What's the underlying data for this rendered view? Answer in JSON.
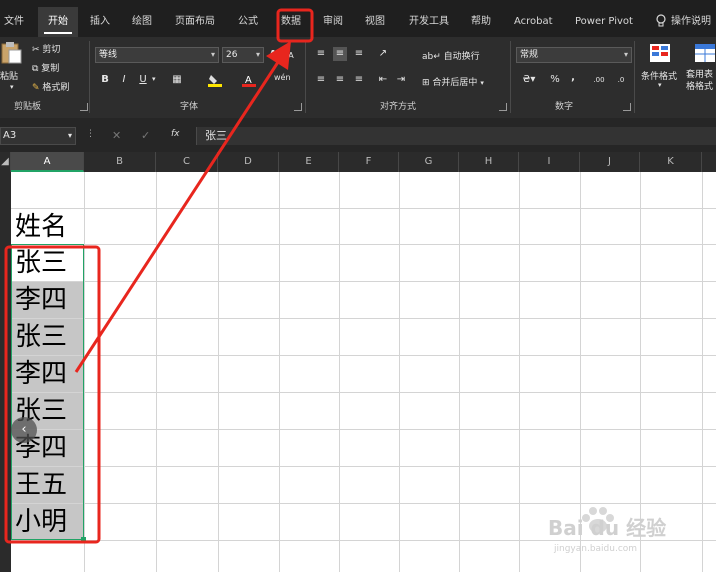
{
  "tabs": [
    {
      "label": "文件"
    },
    {
      "label": "开始"
    },
    {
      "label": "插入"
    },
    {
      "label": "绘图"
    },
    {
      "label": "页面布局"
    },
    {
      "label": "公式"
    },
    {
      "label": "数据"
    },
    {
      "label": "审阅"
    },
    {
      "label": "视图"
    },
    {
      "label": "开发工具"
    },
    {
      "label": "帮助"
    },
    {
      "label": "Acrobat"
    },
    {
      "label": "Power Pivot"
    }
  ],
  "active_tab": "开始",
  "highlighted_tab": "数据",
  "tell_me": "操作说明",
  "ribbon": {
    "clipboard": {
      "paste": "粘贴",
      "cut": "剪切",
      "copy": "复制",
      "format_painter": "格式刷",
      "group_label": "剪贴板"
    },
    "font": {
      "font_name": "等线",
      "font_size": "26",
      "bold": "B",
      "italic": "I",
      "underline": "U",
      "grow": "A",
      "shrink": "A",
      "phonetic": "wén",
      "group_label": "字体"
    },
    "alignment": {
      "wrap_text": "自动换行",
      "merge_center": "合并后居中",
      "group_label": "对齐方式"
    },
    "number": {
      "format": "常规",
      "percent": "%",
      "comma": ",",
      "group_label": "数字"
    },
    "styles": {
      "conditional_format": "条件格式",
      "table_format": "套用表格格式"
    }
  },
  "formula_bar": {
    "name_box": "A3",
    "fx": "fx",
    "content": "张三"
  },
  "columns": [
    "A",
    "B",
    "C",
    "D",
    "E",
    "F",
    "G",
    "H",
    "I",
    "J",
    "K"
  ],
  "selected_column": "A",
  "cells_col_a": [
    "姓名",
    "张三",
    "李四",
    "张三",
    "李四",
    "张三",
    "李四",
    "王五",
    "小明"
  ],
  "watermark": {
    "brand": "Bai du 经验",
    "url": "jingyan.baidu.com"
  },
  "colors": {
    "highlight": "#e8261e",
    "selection_border": "#21a366",
    "selected_fill": "#c6c6c6"
  }
}
